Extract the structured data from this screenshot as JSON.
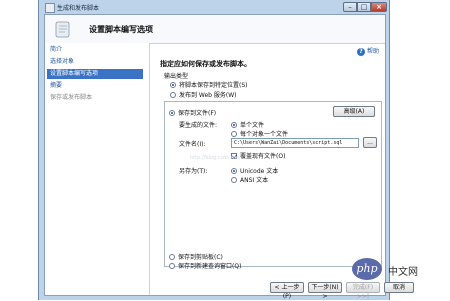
{
  "window": {
    "title": "生成和发布脚本"
  },
  "header": {
    "title": "设置脚本编写选项"
  },
  "sidebar": {
    "items": [
      {
        "label": "简介"
      },
      {
        "label": "选择对象"
      },
      {
        "label": "设置脚本编写选项"
      },
      {
        "label": "摘要"
      },
      {
        "label": "保存或发布脚本"
      }
    ]
  },
  "help": {
    "label": "帮助"
  },
  "main": {
    "section_title": "指定应如何保存或发布脚本。",
    "output_type_label": "输出类型",
    "output_options": [
      "将脚本保存到特定位置(S)",
      "发布到 Web 服务(W)"
    ],
    "save_to_file": "保存到文件(F)",
    "advanced_button": "高级(A)",
    "files_to_generate_label": "要生成的文件:",
    "files_options": [
      "单个文件",
      "每个对象一个文件"
    ],
    "filename_label": "文件名(I):",
    "filename_value": "C:\\Users\\WanZai\\Documents\\script.sql",
    "browse_button": "...",
    "overwrite_label": "覆盖现有文件(O)",
    "save_as_label": "另存为(T):",
    "save_as_options": [
      "Unicode 文本",
      "ANSI 文本"
    ],
    "save_to_clipboard": "保存到剪贴板(C)",
    "save_to_new_query": "保存到新建查询窗口(Q)"
  },
  "footer": {
    "prev": "< 上一步(P)",
    "next": "下一步(N) >",
    "finish": "完成(F) >>|",
    "cancel": "取消"
  },
  "watermark": {
    "logo": "php",
    "text": "中文网",
    "faint": "http://blog.csdn.net/"
  }
}
